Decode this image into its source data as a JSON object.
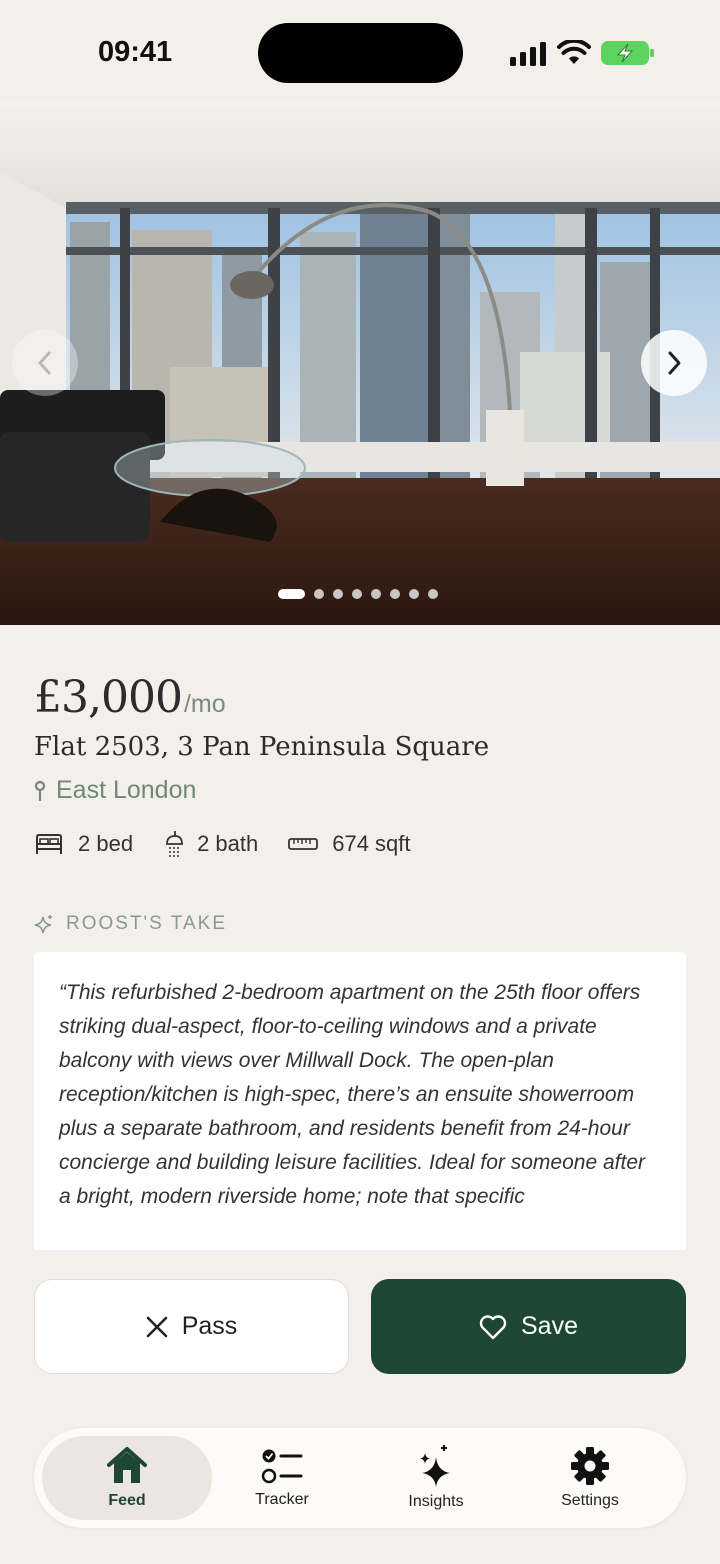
{
  "status_bar": {
    "time": "09:41"
  },
  "gallery": {
    "photo_count": 8,
    "active_index": 0,
    "prev_icon": "chevron-left-icon",
    "next_icon": "chevron-right-icon"
  },
  "listing": {
    "price": "£3,000",
    "price_unit": "/mo",
    "address": "Flat 2503, 3 Pan Peninsula Square",
    "area": "East London",
    "features": {
      "beds": "2 bed",
      "baths": "2 bath",
      "size": "674 sqft"
    }
  },
  "roosts_take": {
    "label": "ROOST'S TAKE",
    "text": "“This refurbished 2-bedroom apartment on the 25th floor offers striking dual-aspect, floor-to-ceiling windows and a private balcony with views over Millwall Dock. The open-plan reception/kitchen is high-spec, there’s an ensuite showerroom plus a separate bathroom, and residents benefit from 24-hour concierge and building leisure facilities. Ideal for someone after a bright, modern riverside home; note that specific"
  },
  "actions": {
    "pass_label": "Pass",
    "save_label": "Save"
  },
  "tabbar": {
    "items": [
      {
        "label": "Feed",
        "icon": "home-icon",
        "active": true
      },
      {
        "label": "Tracker",
        "icon": "checklist-icon",
        "active": false
      },
      {
        "label": "Insights",
        "icon": "sparkles-icon",
        "active": false
      },
      {
        "label": "Settings",
        "icon": "gear-icon",
        "active": false
      }
    ]
  },
  "colors": {
    "background": "#f3efea",
    "accent": "#1d4732",
    "muted_green": "#6f8a74"
  }
}
